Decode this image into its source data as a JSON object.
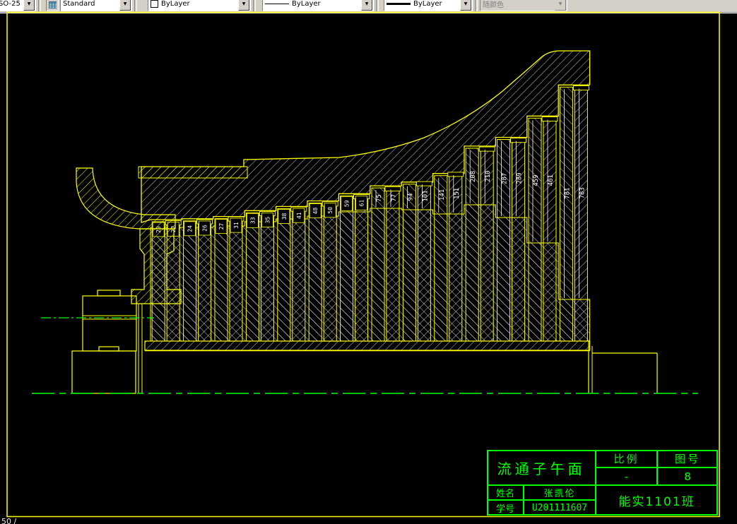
{
  "toolbar": {
    "dim_style": {
      "value": "SO-25"
    },
    "text_style": {
      "value": "Standard",
      "icon": "table-style-icon"
    },
    "color_control": {
      "value": "ByLayer",
      "swatch": "#ffffff"
    },
    "linetype_control": {
      "value": "ByLayer"
    },
    "lineweight_control": {
      "value": "ByLayer"
    },
    "plot_style_control": {
      "value": "随颜色",
      "disabled": true
    }
  },
  "statusbar_fragment": "50 /",
  "colors": {
    "background": "#000000",
    "outline": "#ffff00",
    "hatch": "#ffffff",
    "centerline": "#00ff00",
    "titleblock": "#00ff00",
    "dim_text": "#ffffff"
  },
  "drawing": {
    "description": "turbine flow-path meridional section, 14 stages, stator/rotor blade rows with height dimensions in mm",
    "blade_rows": [
      {
        "label": "20",
        "mm": 20
      },
      {
        "label": "22",
        "mm": 22
      },
      {
        "label": "24",
        "mm": 24
      },
      {
        "label": "26",
        "mm": 26
      },
      {
        "label": "27",
        "mm": 27
      },
      {
        "label": "31",
        "mm": 31
      },
      {
        "label": "33",
        "mm": 33
      },
      {
        "label": "35",
        "mm": 35
      },
      {
        "label": "38",
        "mm": 38
      },
      {
        "label": "41",
        "mm": 41
      },
      {
        "label": "48",
        "mm": 48
      },
      {
        "label": "50",
        "mm": 50
      },
      {
        "label": "59",
        "mm": 59
      },
      {
        "label": "61",
        "mm": 61
      },
      {
        "label": "75",
        "mm": 75
      },
      {
        "label": "77",
        "mm": 77
      },
      {
        "label": "94",
        "mm": 94
      },
      {
        "label": "101",
        "mm": 101
      },
      {
        "label": "141",
        "mm": 141
      },
      {
        "label": "151",
        "mm": 151
      },
      {
        "label": "208",
        "mm": 208
      },
      {
        "label": "210",
        "mm": 210
      },
      {
        "label": "287",
        "mm": 287
      },
      {
        "label": "289",
        "mm": 289
      },
      {
        "label": "459",
        "mm": 459
      },
      {
        "label": "461",
        "mm": 461
      },
      {
        "label": "781",
        "mm": 781
      },
      {
        "label": "783",
        "mm": 783
      }
    ]
  },
  "title_block": {
    "title": "流通子午面",
    "scale_label": "比例",
    "scale_value": "-",
    "number_label": "图号",
    "number_value": "8",
    "name_label": "姓名",
    "name_value": "张凯伦",
    "id_label": "学号",
    "id_value": "U201111607",
    "class_value": "能实1101班"
  }
}
